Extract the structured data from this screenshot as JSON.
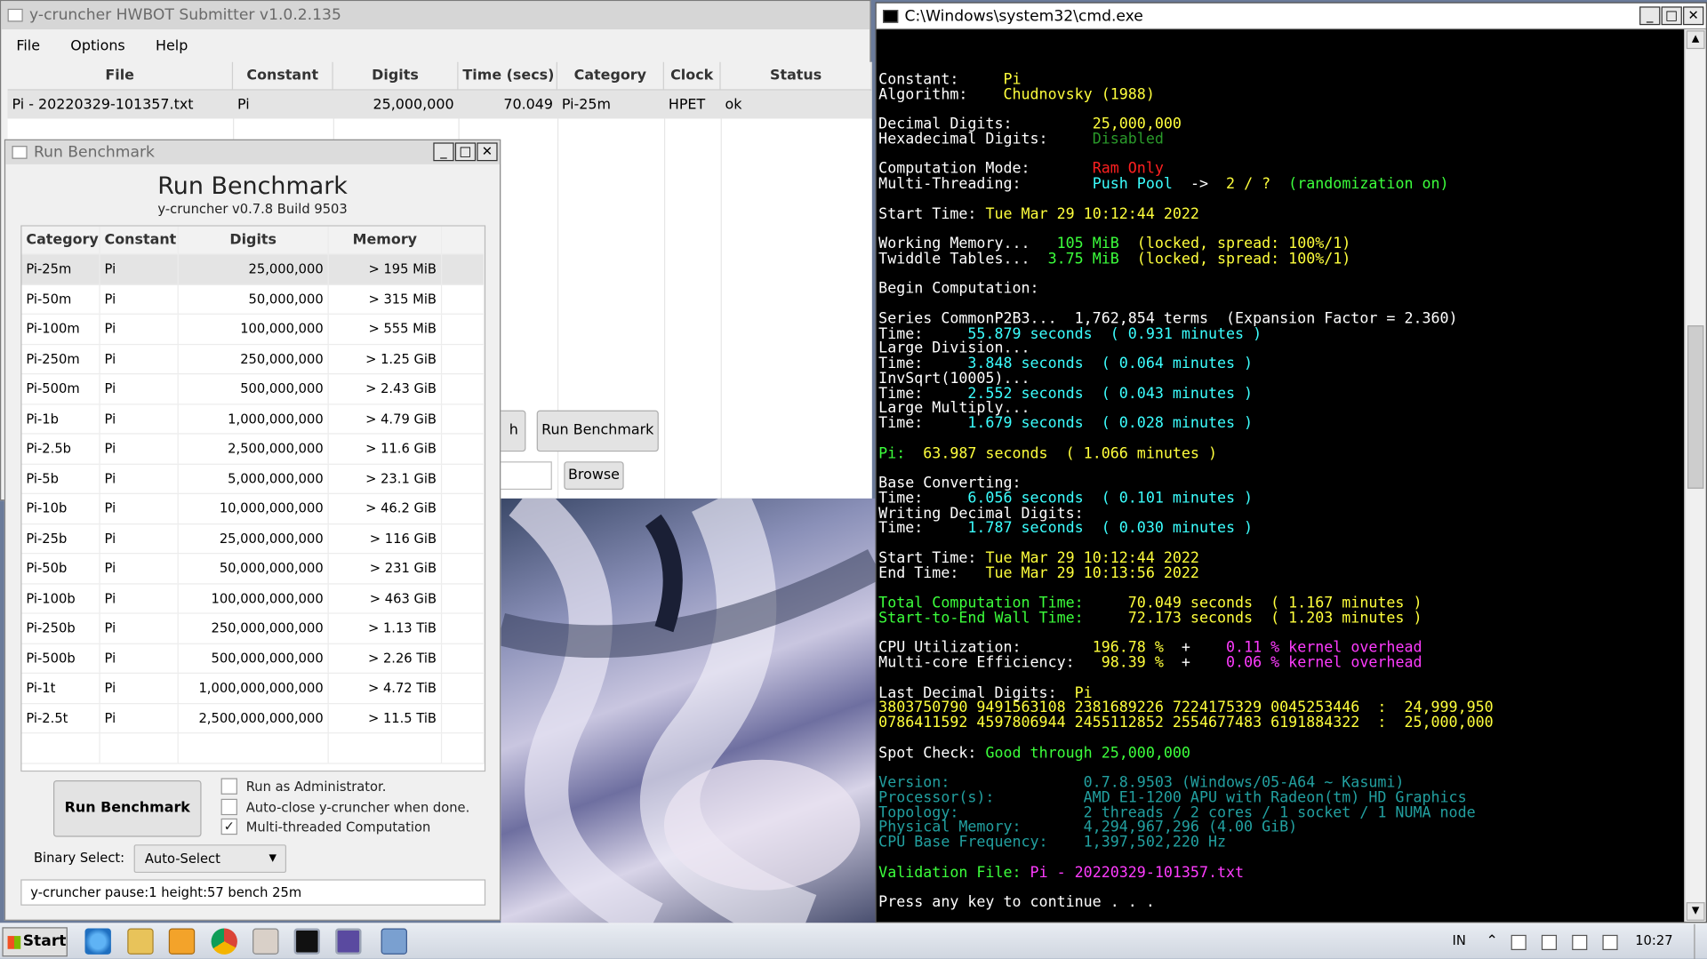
{
  "submitter": {
    "title": "y-cruncher HWBOT Submitter v1.0.2.135",
    "menu": [
      "File",
      "Options",
      "Help"
    ],
    "columns": [
      "File",
      "Constant",
      "Digits",
      "Time (secs)",
      "Category",
      "Clock",
      "Status"
    ],
    "row": {
      "file": "Pi - 20220329-101357.txt",
      "constant": "Pi",
      "digits": "25,000,000",
      "time": "70.049",
      "category": "Pi-25m",
      "clock": "HPET",
      "status": "ok"
    },
    "run_benchmark_button": "Run Benchmark",
    "partial_button": "h",
    "browse_button": "Browse"
  },
  "bench": {
    "window_title": "Run Benchmark",
    "heading": "Run Benchmark",
    "subheading": "y-cruncher v0.7.8 Build 9503",
    "columns": [
      "Category",
      "Constant",
      "Digits",
      "Memory"
    ],
    "rows": [
      {
        "category": "Pi-25m",
        "constant": "Pi",
        "digits": "25,000,000",
        "memory": "> 195 MiB"
      },
      {
        "category": "Pi-50m",
        "constant": "Pi",
        "digits": "50,000,000",
        "memory": "> 315 MiB"
      },
      {
        "category": "Pi-100m",
        "constant": "Pi",
        "digits": "100,000,000",
        "memory": "> 555 MiB"
      },
      {
        "category": "Pi-250m",
        "constant": "Pi",
        "digits": "250,000,000",
        "memory": "> 1.25 GiB"
      },
      {
        "category": "Pi-500m",
        "constant": "Pi",
        "digits": "500,000,000",
        "memory": "> 2.43 GiB"
      },
      {
        "category": "Pi-1b",
        "constant": "Pi",
        "digits": "1,000,000,000",
        "memory": "> 4.79 GiB"
      },
      {
        "category": "Pi-2.5b",
        "constant": "Pi",
        "digits": "2,500,000,000",
        "memory": "> 11.6 GiB"
      },
      {
        "category": "Pi-5b",
        "constant": "Pi",
        "digits": "5,000,000,000",
        "memory": "> 23.1 GiB"
      },
      {
        "category": "Pi-10b",
        "constant": "Pi",
        "digits": "10,000,000,000",
        "memory": "> 46.2 GiB"
      },
      {
        "category": "Pi-25b",
        "constant": "Pi",
        "digits": "25,000,000,000",
        "memory": "> 116 GiB"
      },
      {
        "category": "Pi-50b",
        "constant": "Pi",
        "digits": "50,000,000,000",
        "memory": "> 231 GiB"
      },
      {
        "category": "Pi-100b",
        "constant": "Pi",
        "digits": "100,000,000,000",
        "memory": "> 463 GiB"
      },
      {
        "category": "Pi-250b",
        "constant": "Pi",
        "digits": "250,000,000,000",
        "memory": "> 1.13 TiB"
      },
      {
        "category": "Pi-500b",
        "constant": "Pi",
        "digits": "500,000,000,000",
        "memory": "> 2.26 TiB"
      },
      {
        "category": "Pi-1t",
        "constant": "Pi",
        "digits": "1,000,000,000,000",
        "memory": "> 4.72 TiB"
      },
      {
        "category": "Pi-2.5t",
        "constant": "Pi",
        "digits": "2,500,000,000,000",
        "memory": "> 11.5 TiB"
      }
    ],
    "run_button": "Run Benchmark",
    "options": [
      {
        "label": "Run as Administrator.",
        "checked": false
      },
      {
        "label": "Auto-close y-cruncher when done.",
        "checked": false
      },
      {
        "label": "Multi-threaded Computation",
        "checked": true
      }
    ],
    "binary_label": "Binary Select:",
    "binary_value": "Auto-Select",
    "args": "y-cruncher pause:1 height:57 bench 25m"
  },
  "cmd": {
    "title": "C:\\Windows\\system32\\cmd.exe",
    "lines": [
      [],
      [
        [
          "Constant:     ",
          "fw"
        ],
        [
          "Pi",
          "fy"
        ]
      ],
      [
        [
          "Algorithm:    ",
          "fw"
        ],
        [
          "Chudnovsky (1988)",
          "fy"
        ]
      ],
      [],
      [
        [
          "Decimal Digits:         ",
          "fw"
        ],
        [
          "25,000,000",
          "fy"
        ]
      ],
      [
        [
          "Hexadecimal Digits:     ",
          "fw"
        ],
        [
          "Disabled",
          "fdg"
        ]
      ],
      [],
      [
        [
          "Computation Mode:       ",
          "fw"
        ],
        [
          "Ram Only",
          "fr"
        ]
      ],
      [
        [
          "Multi-Threading:        ",
          "fw"
        ],
        [
          "Push Pool",
          "fc"
        ],
        [
          "  ->  ",
          "fw"
        ],
        [
          "2 / ?",
          "fy"
        ],
        [
          "  (randomization on)",
          "fg"
        ]
      ],
      [],
      [
        [
          "Start Time: ",
          "fw"
        ],
        [
          "Tue Mar 29 10:12:44 2022",
          "fy"
        ]
      ],
      [],
      [
        [
          "Working Memory...   ",
          "fw"
        ],
        [
          "105 MiB",
          "fg"
        ],
        [
          "  (locked, spread: 100%/1)",
          "fy"
        ]
      ],
      [
        [
          "Twiddle Tables...  ",
          "fw"
        ],
        [
          "3.75 MiB",
          "fg"
        ],
        [
          "  (locked, spread: 100%/1)",
          "fy"
        ]
      ],
      [],
      [
        [
          "Begin Computation:",
          "fw"
        ]
      ],
      [],
      [
        [
          "Series CommonP2B3...  1,762,854 terms  (Expansion Factor = 2.360)",
          "fw"
        ]
      ],
      [
        [
          "Time:     ",
          "fw"
        ],
        [
          "55.879 seconds  ( 0.931 minutes )",
          "fc"
        ]
      ],
      [
        [
          "Large Division...",
          "fw"
        ]
      ],
      [
        [
          "Time:     ",
          "fw"
        ],
        [
          "3.848 seconds  ( 0.064 minutes )",
          "fc"
        ]
      ],
      [
        [
          "InvSqrt(10005)...",
          "fw"
        ]
      ],
      [
        [
          "Time:     ",
          "fw"
        ],
        [
          "2.552 seconds  ( 0.043 minutes )",
          "fc"
        ]
      ],
      [
        [
          "Large Multiply...",
          "fw"
        ]
      ],
      [
        [
          "Time:     ",
          "fw"
        ],
        [
          "1.679 seconds  ( 0.028 minutes )",
          "fc"
        ]
      ],
      [],
      [
        [
          "Pi:  ",
          "fg"
        ],
        [
          "63.987 seconds  ( 1.066 minutes )",
          "fy"
        ]
      ],
      [],
      [
        [
          "Base Converting:",
          "fw"
        ]
      ],
      [
        [
          "Time:     ",
          "fw"
        ],
        [
          "6.056 seconds  ( 0.101 minutes )",
          "fc"
        ]
      ],
      [
        [
          "Writing Decimal Digits:",
          "fw"
        ]
      ],
      [
        [
          "Time:     ",
          "fw"
        ],
        [
          "1.787 seconds  ( 0.030 minutes )",
          "fc"
        ]
      ],
      [],
      [
        [
          "Start Time: ",
          "fw"
        ],
        [
          "Tue Mar 29 10:12:44 2022",
          "fy"
        ]
      ],
      [
        [
          "End Time:   ",
          "fw"
        ],
        [
          "Tue Mar 29 10:13:56 2022",
          "fy"
        ]
      ],
      [],
      [
        [
          "Total Computation Time:     ",
          "fg"
        ],
        [
          "70.049 seconds  ( 1.167 minutes )",
          "fy"
        ]
      ],
      [
        [
          "Start-to-End Wall Time:     ",
          "fg"
        ],
        [
          "72.173 seconds  ( 1.203 minutes )",
          "fy"
        ]
      ],
      [],
      [
        [
          "CPU Utilization:        ",
          "fw"
        ],
        [
          "196.78 %",
          "fy"
        ],
        [
          "  +    ",
          "fw"
        ],
        [
          "0.11 % kernel overhead",
          "fm"
        ]
      ],
      [
        [
          "Multi-core Efficiency:   ",
          "fw"
        ],
        [
          "98.39 %",
          "fy"
        ],
        [
          "  +    ",
          "fw"
        ],
        [
          "0.06 % kernel overhead",
          "fm"
        ]
      ],
      [],
      [
        [
          "Last Decimal Digits:  ",
          "fw"
        ],
        [
          "Pi",
          "fy"
        ]
      ],
      [
        [
          "3803750790 9491563108 2381689226 7224175329 0045253446  :  24,999,950",
          "fy"
        ]
      ],
      [
        [
          "0786411592 4597806944 2455112852 2554677483 6191884322  :  25,000,000",
          "fy"
        ]
      ],
      [],
      [
        [
          "Spot Check: ",
          "fw"
        ],
        [
          "Good through 25,000,000",
          "fg"
        ]
      ],
      [],
      [
        [
          "Version:               0.7.8.9503 (Windows/05-A64 ~ Kasumi)",
          "fdc"
        ]
      ],
      [
        [
          "Processor(s):          AMD E1-1200 APU with Radeon(tm) HD Graphics",
          "fdc"
        ]
      ],
      [
        [
          "Topology:              2 threads / 2 cores / 1 socket / 1 NUMA node",
          "fdc"
        ]
      ],
      [
        [
          "Physical Memory:       4,294,967,296 (4.00 GiB)",
          "fdc"
        ]
      ],
      [
        [
          "CPU Base Frequency:    1,397,502,220 Hz",
          "fdc"
        ]
      ],
      [],
      [
        [
          "Validation File: ",
          "fg"
        ],
        [
          "Pi - 20220329-101357.txt",
          "fm"
        ]
      ],
      [],
      [
        [
          "Press any key to continue . . .",
          "fw"
        ]
      ]
    ]
  },
  "taskbar": {
    "start": "Start",
    "lang": "IN",
    "clock": "10:27"
  }
}
